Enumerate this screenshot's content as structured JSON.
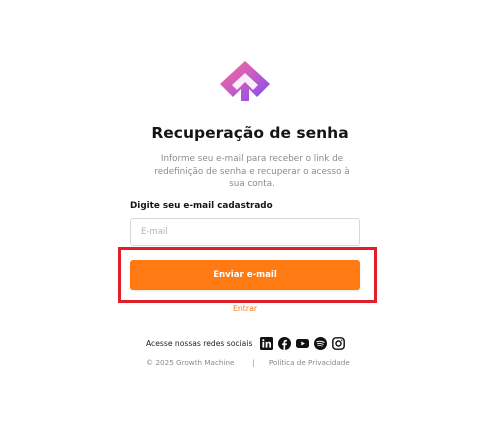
{
  "page": {
    "title": "Recuperação de senha",
    "subtitle": "Informe seu e-mail para receber o link de redefinição de senha e recuperar o acesso à sua conta."
  },
  "form": {
    "email_label": "Digite seu e-mail cadastrado",
    "email_placeholder": "E-mail",
    "email_value": "",
    "submit_label": "Enviar e-mail",
    "login_link": "Entrar"
  },
  "social": {
    "label": "Acesse nossas redes sociais",
    "icons": [
      "linkedin-icon",
      "facebook-icon",
      "youtube-icon",
      "spotify-icon",
      "instagram-icon"
    ]
  },
  "footer": {
    "copyright": "© 2025 Growth Machine",
    "separator": "|",
    "privacy": "Política de Privacidade"
  },
  "colors": {
    "accent": "#ff7a12",
    "highlight": "#e11f2a",
    "logo_gradient_start": "#ff6b8a",
    "logo_gradient_end": "#7a4cf0"
  }
}
